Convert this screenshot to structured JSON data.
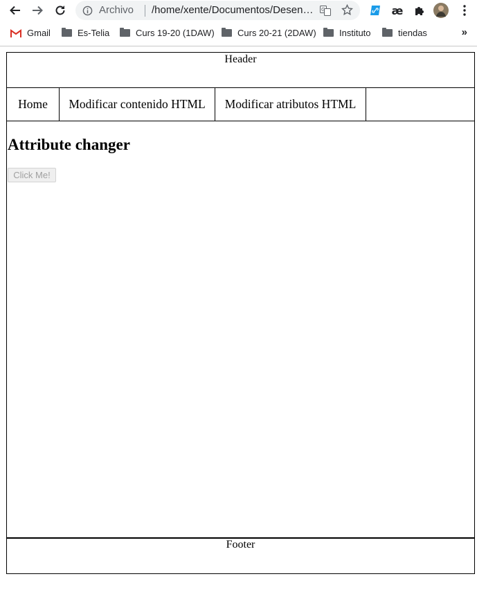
{
  "browser": {
    "omnibox": {
      "security_chip": "Archivo",
      "url": "/home/xente/Documentos/Desenvolvemento/web/index.html"
    },
    "extensions": [
      {
        "icon": "link-extension-icon"
      },
      {
        "icon": "ae-extension-icon",
        "label": "æ"
      },
      {
        "icon": "puzzle-icon"
      },
      {
        "icon": "avatar"
      },
      {
        "icon": "kebab-menu-icon"
      }
    ],
    "bookmarks": [
      {
        "label": "Gmail",
        "icon": "gmail-icon"
      },
      {
        "label": "Es-Telia",
        "icon": "folder-icon"
      },
      {
        "label": "Curs 19-20 (1DAW)",
        "icon": "folder-icon"
      },
      {
        "label": "Curs 20-21 (2DAW)",
        "icon": "folder-icon"
      },
      {
        "label": "Instituto",
        "icon": "folder-icon"
      },
      {
        "label": "tiendas",
        "icon": "folder-icon"
      }
    ],
    "bookmarks_more": "»"
  },
  "page": {
    "header": "Header",
    "nav": [
      {
        "label": "Home"
      },
      {
        "label": "Modificar contenido HTML"
      },
      {
        "label": "Modificar atributos HTML"
      }
    ],
    "title": "Attribute changer",
    "button_label": "Click Me!",
    "button_disabled": true,
    "footer": "Footer"
  }
}
